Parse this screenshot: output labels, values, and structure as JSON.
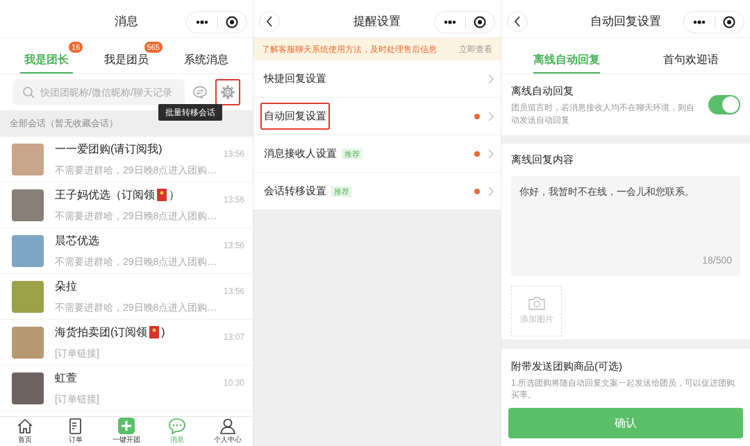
{
  "panels": [
    {
      "title": "消息",
      "back": false,
      "tabs": [
        {
          "label": "我是团长",
          "badge": "16",
          "selected": true
        },
        {
          "label": "我是团员",
          "badge": "565",
          "selected": false
        },
        {
          "label": "系统消息",
          "selected": false
        }
      ],
      "search": {
        "placeholder": "快团团昵称/微信昵称/聊天记录"
      },
      "settings_highlighted": true,
      "tooltip": "批量转移会话",
      "section_label": "全部会话（暂无收藏会话）",
      "chats": [
        {
          "name": "一一爱团购(请订阅我)",
          "envelope": false,
          "preview": "不需要进群哈，29日晚8点进入团购…",
          "time": "13:56",
          "color": "#c9a58a"
        },
        {
          "name": "王子妈优选（订阅领",
          "envelope": true,
          "name_tail": "）",
          "preview": "不需要进群哈，29日晚8点进入团购…",
          "time": "13:56",
          "color": "#8a7f76"
        },
        {
          "name": "晨芯优选",
          "envelope": false,
          "preview": "不需要进群哈，29日晚8点进入团购…",
          "time": "13:56",
          "color": "#7fa6c4"
        },
        {
          "name": "朵拉",
          "envelope": false,
          "preview": "不需要进群哈，29日晚8点进入团购…",
          "time": "13:56",
          "color": "#9aa24a"
        },
        {
          "name": "海货拍卖团(订阅领",
          "envelope": true,
          "name_tail": ")",
          "preview": "[订单链接]",
          "time": "13:07",
          "color": "#b79a72"
        },
        {
          "name": "虹萱",
          "envelope": false,
          "preview": "[订单链接]",
          "time": "10:30",
          "color": "#6f6360"
        }
      ],
      "nav": [
        {
          "label": "首页",
          "kind": "home",
          "selected": false
        },
        {
          "label": "订单",
          "kind": "order",
          "selected": false
        },
        {
          "label": "一键开团",
          "kind": "plus",
          "selected": false
        },
        {
          "label": "消息",
          "kind": "chat",
          "selected": true
        },
        {
          "label": "个人中心",
          "kind": "person",
          "selected": false
        }
      ]
    },
    {
      "title": "提醒设置",
      "back": true,
      "banner": {
        "text": "了解客服聊天系统使用方法，及时处理售后信息",
        "action": "立即查看"
      },
      "items": [
        {
          "label": "快捷回复设置",
          "dot": false,
          "highlighted": false
        },
        {
          "label": "自动回复设置",
          "dot": true,
          "highlighted": true
        },
        {
          "label": "消息接收人设置",
          "tag": "推荐",
          "dot": true,
          "highlighted": false
        },
        {
          "label": "会话转移设置",
          "tag": "推荐",
          "dot": true,
          "highlighted": false
        }
      ]
    },
    {
      "title": "自动回复设置",
      "back": true,
      "tabs": [
        {
          "label": "离线自动回复",
          "selected": true
        },
        {
          "label": "首句欢迎语",
          "selected": false
        }
      ],
      "toggle": {
        "label": "离线自动回复",
        "description": "团员留言时，若消息接收人均不在聊天环境，则自动发送自动回复",
        "on": true
      },
      "content": {
        "label": "离线回复内容",
        "value": "你好，我暂时不在线，一会儿和您联系。",
        "counter": "18/500",
        "add_image": "添加图片"
      },
      "goods": {
        "title": "附带发送团购商品(可选)",
        "description": "1.所选团购将随自动回复文案一起发送给团员，可以促进团购买率。"
      },
      "confirm": "确认"
    }
  ]
}
